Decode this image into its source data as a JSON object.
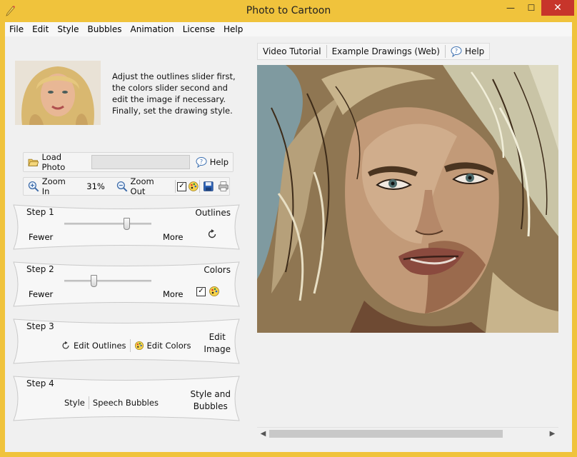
{
  "window": {
    "title": "Photo to Cartoon",
    "minimize": "—",
    "maximize": "☐",
    "close": "✕"
  },
  "menu": [
    "File",
    "Edit",
    "Style",
    "Bubbles",
    "Animation",
    "License",
    "Help"
  ],
  "instructions": "Adjust the outlines slider first, the colors slider second and edit the image if necessary. Finally, set the drawing style.",
  "toolbar1": {
    "load_photo": "Load Photo",
    "path_value": "",
    "help": "Help"
  },
  "toolbar2": {
    "zoom_in": "Zoom In",
    "zoom_level": "31%",
    "zoom_out": "Zoom Out",
    "checked": true
  },
  "steps": [
    {
      "label": "Step 1",
      "title": "Outlines",
      "fewer": "Fewer",
      "more": "More",
      "slider_value": 0.72
    },
    {
      "label": "Step 2",
      "title": "Colors",
      "fewer": "Fewer",
      "more": "More",
      "slider_value": 0.33,
      "checked": true
    },
    {
      "label": "Step 3",
      "title": "Edit Image",
      "title_line1": "Edit",
      "title_line2": "Image",
      "btn1": "Edit Outlines",
      "btn2": "Edit Colors"
    },
    {
      "label": "Step 4",
      "title_line1": "Style and",
      "title_line2": "Bubbles",
      "btn1": "Style",
      "btn2": "Speech Bubbles"
    }
  ],
  "right_toolbar": {
    "video": "Video Tutorial",
    "examples": "Example Drawings (Web)",
    "help": "Help"
  },
  "colors": {
    "title_bar": "#f0c33c",
    "close_button": "#c7352b",
    "panel": "#f0f0f0",
    "sky": "#7f9aa0"
  }
}
